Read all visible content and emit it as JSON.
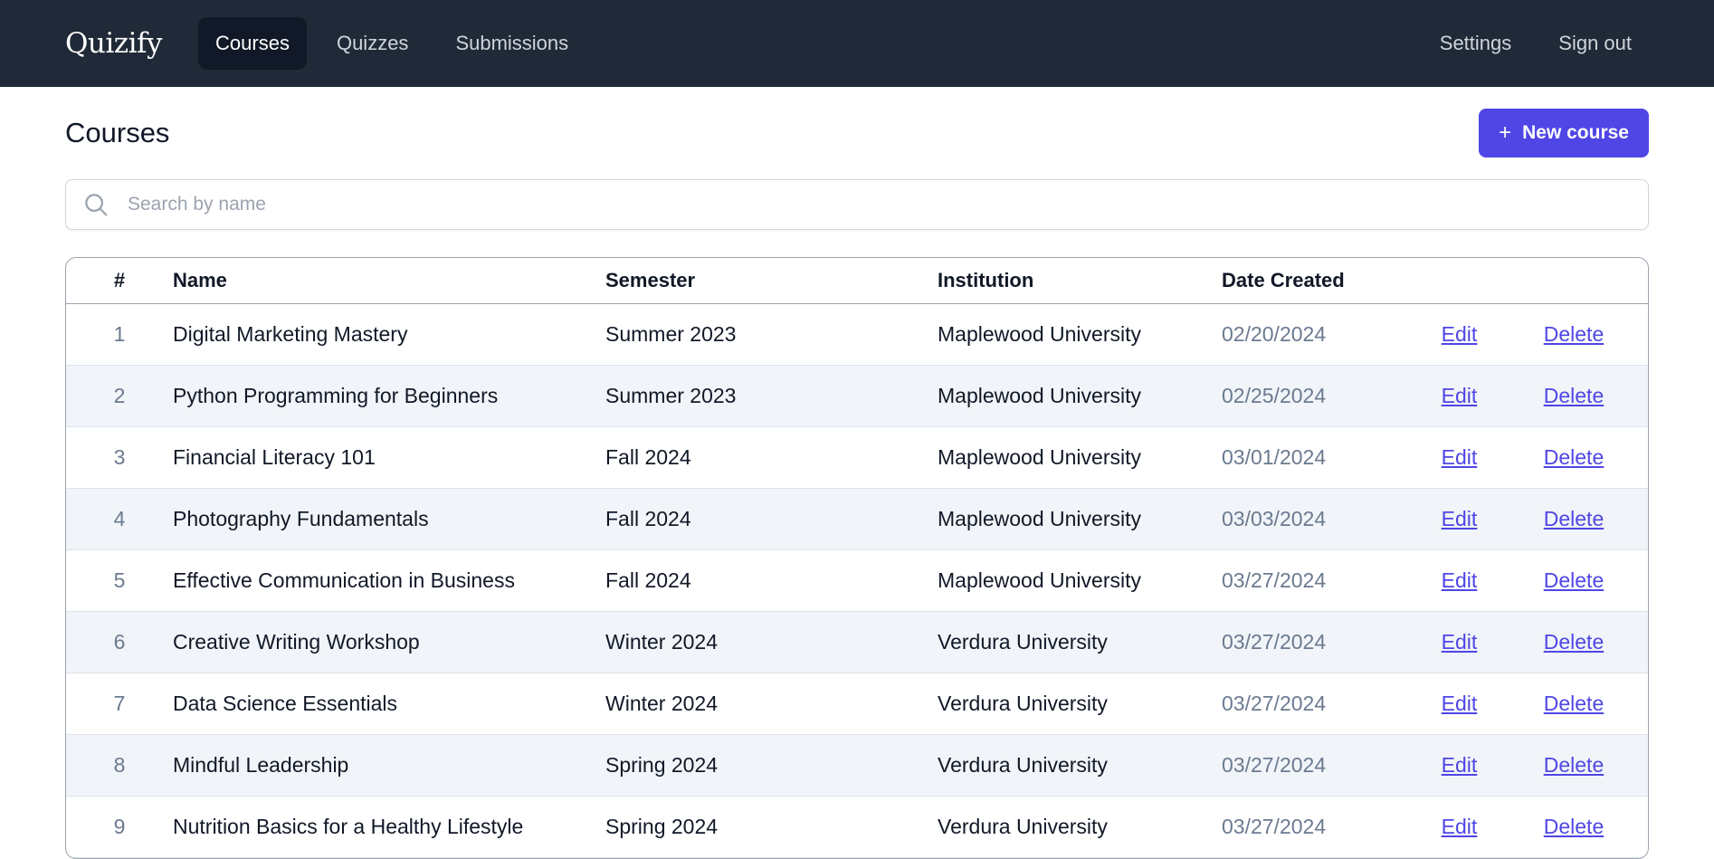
{
  "app": {
    "brand": "Quizify"
  },
  "nav": {
    "items": [
      {
        "label": "Courses",
        "active": true
      },
      {
        "label": "Quizzes",
        "active": false
      },
      {
        "label": "Submissions",
        "active": false
      }
    ],
    "right": [
      {
        "label": "Settings"
      },
      {
        "label": "Sign out"
      }
    ]
  },
  "page": {
    "title": "Courses",
    "new_button": {
      "icon": "+",
      "label": "New course"
    }
  },
  "search": {
    "placeholder": "Search by name",
    "value": ""
  },
  "table": {
    "headers": {
      "num": "#",
      "name": "Name",
      "semester": "Semester",
      "institution": "Institution",
      "date": "Date Created"
    },
    "rows": [
      {
        "num": "1",
        "name": "Digital Marketing Mastery",
        "semester": "Summer 2023",
        "institution": "Maplewood University",
        "date": "02/20/2024",
        "edit": "Edit",
        "delete": "Delete"
      },
      {
        "num": "2",
        "name": "Python Programming for Beginners",
        "semester": "Summer 2023",
        "institution": "Maplewood University",
        "date": "02/25/2024",
        "edit": "Edit",
        "delete": "Delete"
      },
      {
        "num": "3",
        "name": "Financial Literacy 101",
        "semester": "Fall 2024",
        "institution": "Maplewood University",
        "date": "03/01/2024",
        "edit": "Edit",
        "delete": "Delete"
      },
      {
        "num": "4",
        "name": "Photography Fundamentals",
        "semester": "Fall 2024",
        "institution": "Maplewood University",
        "date": "03/03/2024",
        "edit": "Edit",
        "delete": "Delete"
      },
      {
        "num": "5",
        "name": "Effective Communication in Business",
        "semester": "Fall 2024",
        "institution": "Maplewood University",
        "date": "03/27/2024",
        "edit": "Edit",
        "delete": "Delete"
      },
      {
        "num": "6",
        "name": "Creative Writing Workshop",
        "semester": "Winter 2024",
        "institution": "Verdura University",
        "date": "03/27/2024",
        "edit": "Edit",
        "delete": "Delete"
      },
      {
        "num": "7",
        "name": "Data Science Essentials",
        "semester": "Winter 2024",
        "institution": "Verdura University",
        "date": "03/27/2024",
        "edit": "Edit",
        "delete": "Delete"
      },
      {
        "num": "8",
        "name": "Mindful Leadership",
        "semester": "Spring 2024",
        "institution": "Verdura University",
        "date": "03/27/2024",
        "edit": "Edit",
        "delete": "Delete"
      },
      {
        "num": "9",
        "name": "Nutrition Basics for a Healthy Lifestyle",
        "semester": "Spring 2024",
        "institution": "Verdura University",
        "date": "03/27/2024",
        "edit": "Edit",
        "delete": "Delete"
      }
    ]
  },
  "colors": {
    "topbar": "#1f2937",
    "accent": "#4f46e5",
    "muted": "#6b7a90"
  },
  "icons": {
    "search": "search-icon"
  }
}
